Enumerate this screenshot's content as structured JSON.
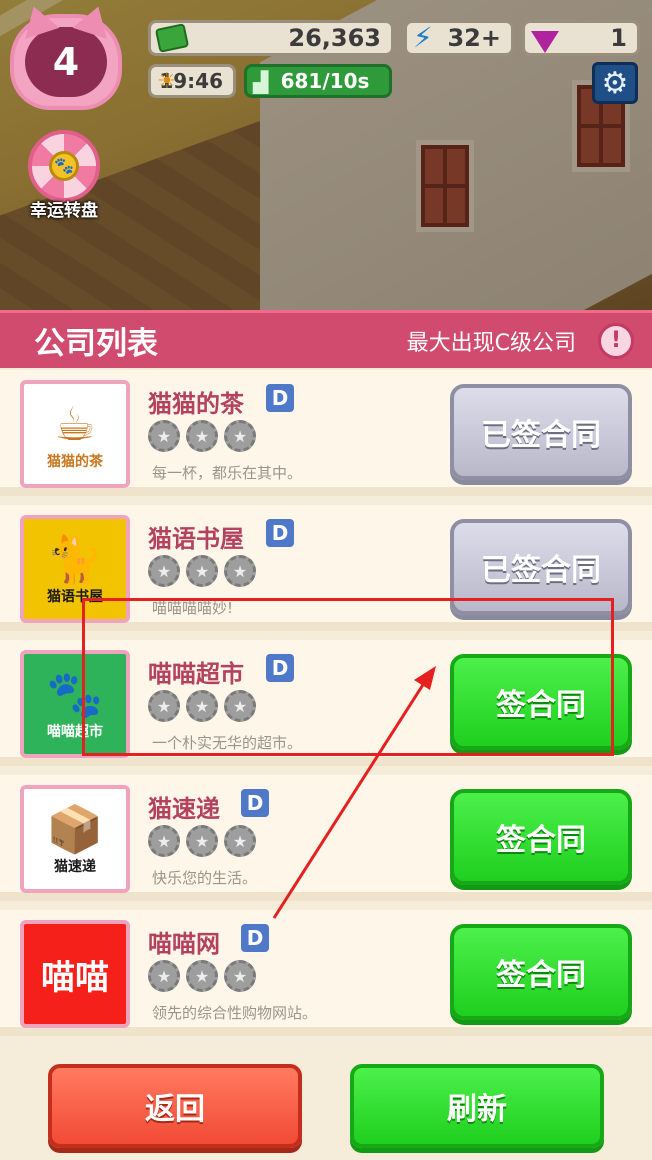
{
  "hud": {
    "level": "4",
    "cash": "26,363",
    "energy": "32",
    "energy_plus": "+",
    "gems": "1",
    "time": "19:46",
    "income": "681/10s",
    "lucky_wheel_label": "幸运转盘",
    "icons": [
      "cash-icon",
      "lightning-icon",
      "gem-icon",
      "sun-icon",
      "income-chart-icon",
      "gear-icon",
      "lucky-wheel-icon"
    ]
  },
  "panel": {
    "title": "公司列表",
    "subtitle": "最大出现C级公司",
    "info_symbol": "!"
  },
  "companies": [
    {
      "name": "猫猫的茶",
      "grade": "D",
      "desc": "每一杯，都乐在其中。",
      "logo_text": "猫猫的茶",
      "logo_glyph": "☕",
      "logo_bg": "#ffffff",
      "logo_fg": "#c9781f",
      "action": "已签合同",
      "signed": true
    },
    {
      "name": "猫语书屋",
      "grade": "D",
      "desc": "喵喵喵喵妙!",
      "logo_text": "猫语书屋",
      "logo_glyph": "🐈",
      "logo_bg": "#f2c300",
      "logo_fg": "#1a1a1a",
      "action": "已签合同",
      "signed": true
    },
    {
      "name": "喵喵超市",
      "grade": "D",
      "desc": "一个朴实无华的超市。",
      "logo_text": "喵喵超市",
      "logo_glyph": "🐾",
      "logo_bg": "#2fb35a",
      "logo_fg": "#ffffff",
      "action": "签合同",
      "signed": false
    },
    {
      "name": "猫速递",
      "grade": "D",
      "desc": "快乐您的生活。",
      "logo_text": "猫速递",
      "logo_glyph": "📦",
      "logo_bg": "#ffffff",
      "logo_fg": "#1a1a1a",
      "action": "签合同",
      "signed": false
    },
    {
      "name": "喵喵网",
      "grade": "D",
      "desc": "领先的综合性购物网站。",
      "logo_text": "喵喵",
      "logo_glyph": "",
      "logo_bg": "#f5201a",
      "logo_fg": "#ffffff",
      "action": "签合同",
      "signed": false
    }
  ],
  "star_symbol": "★",
  "footer": {
    "back_label": "返回",
    "refresh_label": "刷新"
  },
  "colors": {
    "header": "#d14b6e",
    "sign_green": "#2fd62d",
    "signed_gray": "#c4c4d4",
    "back_red": "#f24b35",
    "annotation_red": "#e5201e"
  }
}
